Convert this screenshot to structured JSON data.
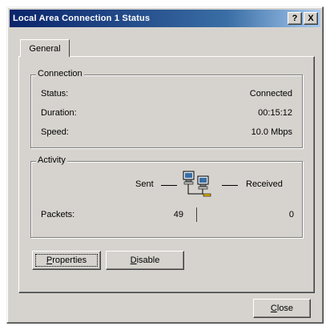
{
  "window": {
    "title": "Local Area Connection 1 Status",
    "help_label": "?",
    "close_label": "X"
  },
  "tabs": [
    {
      "label": "General"
    }
  ],
  "connection": {
    "legend": "Connection",
    "rows": [
      {
        "label": "Status:",
        "value": "Connected"
      },
      {
        "label": "Duration:",
        "value": "00:15:12"
      },
      {
        "label": "Speed:",
        "value": "10.0 Mbps"
      }
    ]
  },
  "activity": {
    "legend": "Activity",
    "sent_label": "Sent",
    "received_label": "Received",
    "packets_label": "Packets:",
    "packets_sent": "49",
    "packets_received": "0",
    "icon": "network-connection-icon"
  },
  "buttons": {
    "properties": {
      "prefix": "",
      "accel": "P",
      "rest": "roperties"
    },
    "disable": {
      "prefix": "",
      "accel": "D",
      "rest": "isable"
    },
    "close": {
      "prefix": "",
      "accel": "C",
      "rest": "lose"
    }
  }
}
